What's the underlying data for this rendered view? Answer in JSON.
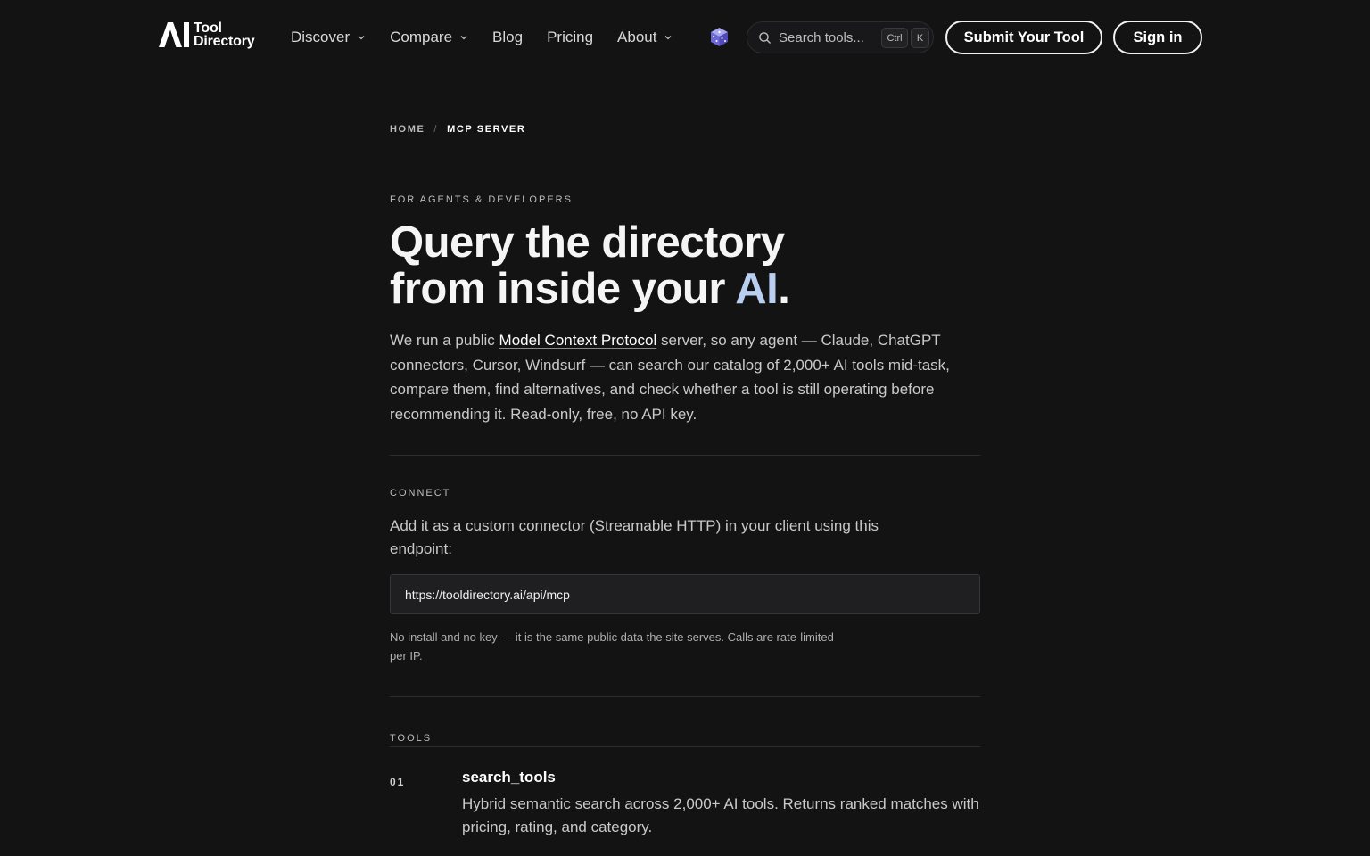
{
  "header": {
    "logo": {
      "line1": "Tool",
      "line2": "Directory",
      "mark": "AI"
    },
    "nav": [
      {
        "label": "Discover",
        "has_dropdown": true
      },
      {
        "label": "Compare",
        "has_dropdown": true
      },
      {
        "label": "Blog",
        "has_dropdown": false
      },
      {
        "label": "Pricing",
        "has_dropdown": false
      },
      {
        "label": "About",
        "has_dropdown": true
      }
    ],
    "random_icon": "dice-icon",
    "search": {
      "placeholder": "Search tools...",
      "shortcut_ctrl": "Ctrl",
      "shortcut_key": "K"
    },
    "submit_label": "Submit Your Tool",
    "signin_label": "Sign in"
  },
  "breadcrumb": {
    "home": "HOME",
    "separator": "/",
    "current": "MCP SERVER"
  },
  "hero": {
    "eyebrow": "FOR AGENTS & DEVELOPERS",
    "title_line1": "Query the directory",
    "title_line2_before": "from inside your ",
    "title_accent": "AI",
    "title_end": ".",
    "accent_color": "#b8cff0",
    "lead_before": "We run a public ",
    "lead_link": "Model Context Protocol",
    "lead_after": " server, so any agent — Claude, ChatGPT connectors, Cursor, Windsurf — can search our catalog of 2,000+ AI tools mid-task, compare them, find alternatives, and check whether a tool is still operating before recommending it. Read-only, free, no API key."
  },
  "connect": {
    "eyebrow": "CONNECT",
    "text": "Add it as a custom connector (Streamable HTTP) in your client using this endpoint:",
    "endpoint": "https://tooldirectory.ai/api/mcp",
    "note": "No install and no key — it is the same public data the site serves. Calls are rate-limited per IP."
  },
  "tools": {
    "eyebrow": "TOOLS",
    "items": [
      {
        "num": "01",
        "name": "search_tools",
        "desc": "Hybrid semantic search across 2,000+ AI tools. Returns ranked matches with pricing, rating, and category."
      }
    ]
  },
  "colors": {
    "background": "#131314",
    "accent": "#b8cff0",
    "text": "#e6e6e6"
  }
}
